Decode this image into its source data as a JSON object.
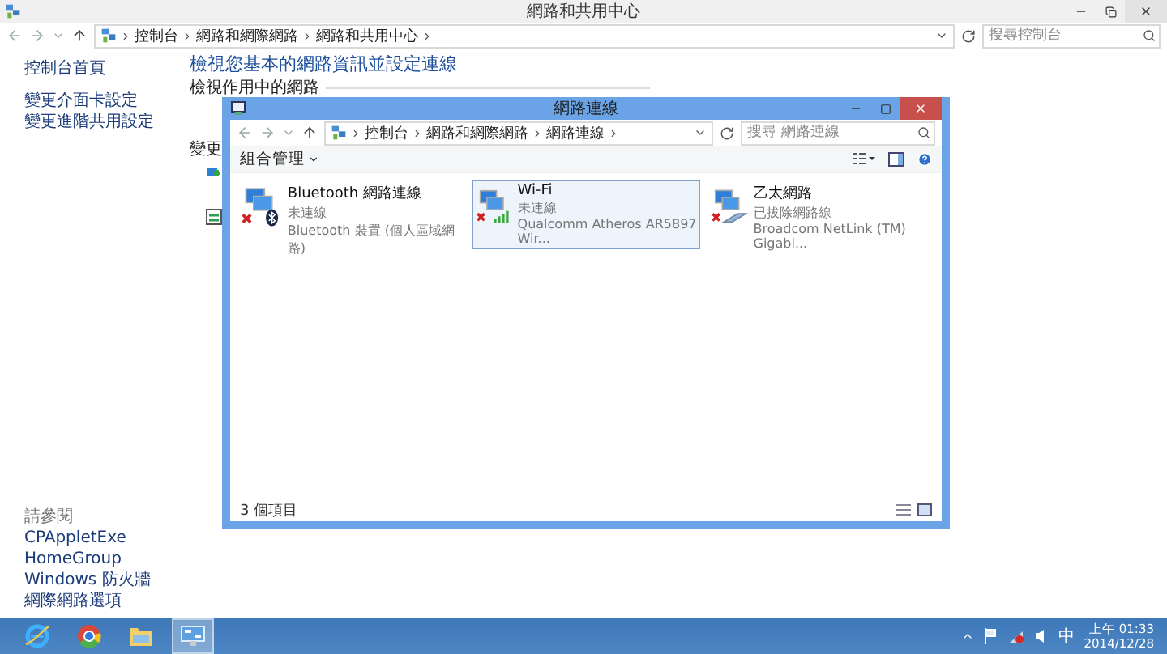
{
  "main_window": {
    "title": "網路和共用中心",
    "breadcrumbs": [
      "控制台",
      "網路和網際網路",
      "網路和共用中心"
    ],
    "search": {
      "placeholder": "搜尋控制台"
    },
    "sidebar": {
      "links": [
        "控制台首頁",
        "變更介面卡設定",
        "變更進階共用設定"
      ],
      "see_also": {
        "heading": "請參閱",
        "links": [
          "CPAppletExe",
          "HomeGroup",
          "Windows 防火牆",
          "網際網路選項"
        ]
      }
    },
    "content": {
      "heading": "檢視您基本的網路資訊並設定連線",
      "active_networks_label": "檢視作用中的網路",
      "change_label": "變更"
    }
  },
  "network_window": {
    "title": "網路連線",
    "breadcrumbs": [
      "控制台",
      "網路和網際網路",
      "網路連線"
    ],
    "search": {
      "placeholder": "搜尋 網路連線"
    },
    "organize": "組合管理",
    "connections": [
      {
        "kind": "bluetooth",
        "name": "Bluetooth 網路連線",
        "status": "未連線",
        "device": "Bluetooth 裝置 (個人區域網路)",
        "selected": false
      },
      {
        "kind": "wifi",
        "name": "Wi-Fi",
        "status": "未連線",
        "device": "Qualcomm Atheros AR5897 Wir...",
        "selected": true
      },
      {
        "kind": "ethernet",
        "name": "乙太網路",
        "status": "已拔除網路線",
        "device": "Broadcom NetLink (TM) Gigabi...",
        "selected": false
      }
    ],
    "status_bar": "3 個項目"
  },
  "taskbar": {
    "apps": [
      {
        "kind": "browser-e",
        "active": false
      },
      {
        "kind": "browser-ring",
        "active": false
      },
      {
        "kind": "folder",
        "active": false
      },
      {
        "kind": "control-panel",
        "active": true
      }
    ],
    "tray": {
      "ime": "中",
      "time": "上午 01:33",
      "date": "2014/12/28"
    }
  }
}
